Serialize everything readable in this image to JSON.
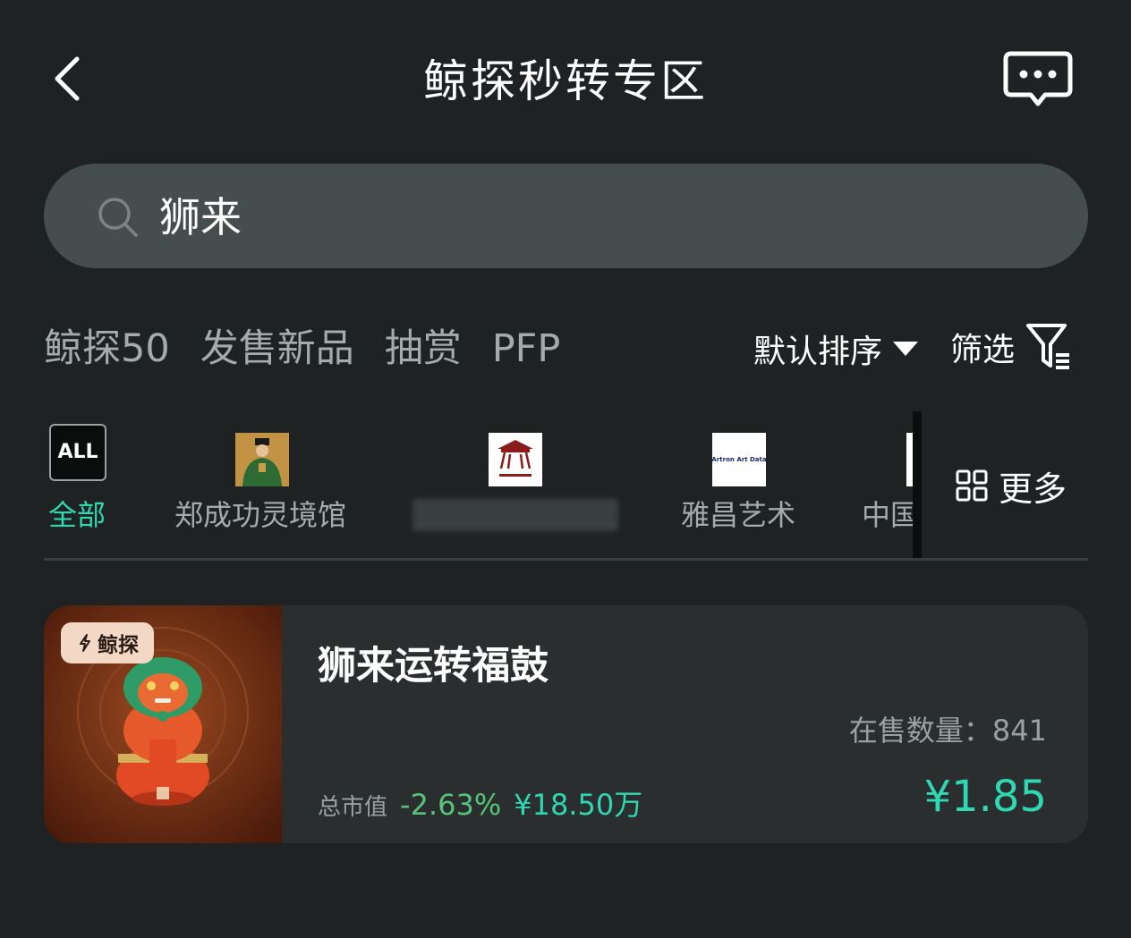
{
  "header": {
    "title": "鲸探秒转专区",
    "back_icon": "chevron-left-icon",
    "message_icon": "chat-bubble-icon"
  },
  "search": {
    "value": "狮来",
    "icon": "search-icon"
  },
  "category_tabs": [
    "鲸探50",
    "发售新品",
    "抽赏",
    "PFP"
  ],
  "sort": {
    "label": "默认排序",
    "icon": "caret-down-icon"
  },
  "filter": {
    "label": "筛选",
    "icon": "funnel-icon"
  },
  "brands": {
    "all_logo_text": "ALL",
    "items": [
      {
        "label": "全部",
        "active": true
      },
      {
        "label": "郑成功灵境馆",
        "active": false
      },
      {
        "label": "",
        "active": false
      },
      {
        "label": "雅昌艺术",
        "active": false
      },
      {
        "label": "中国",
        "active": false
      }
    ],
    "artron_logo_text": "Artron Art Data",
    "more_label": "更多",
    "more_icon": "grid-icon"
  },
  "product": {
    "badge": "鲸探",
    "badge_icon": "lightning-icon",
    "title": "狮来运转福鼓",
    "stock_text": "在售数量：841",
    "mcap_label": "总市值",
    "mcap_change": "-2.63%",
    "mcap_value": "¥18.50万",
    "price": "¥1.85"
  },
  "colors": {
    "background": "#1f2223",
    "accent": "#2fd7b2",
    "positive_change": "#58c47a",
    "card": "#2a2e2e",
    "search": "#454e4d"
  }
}
